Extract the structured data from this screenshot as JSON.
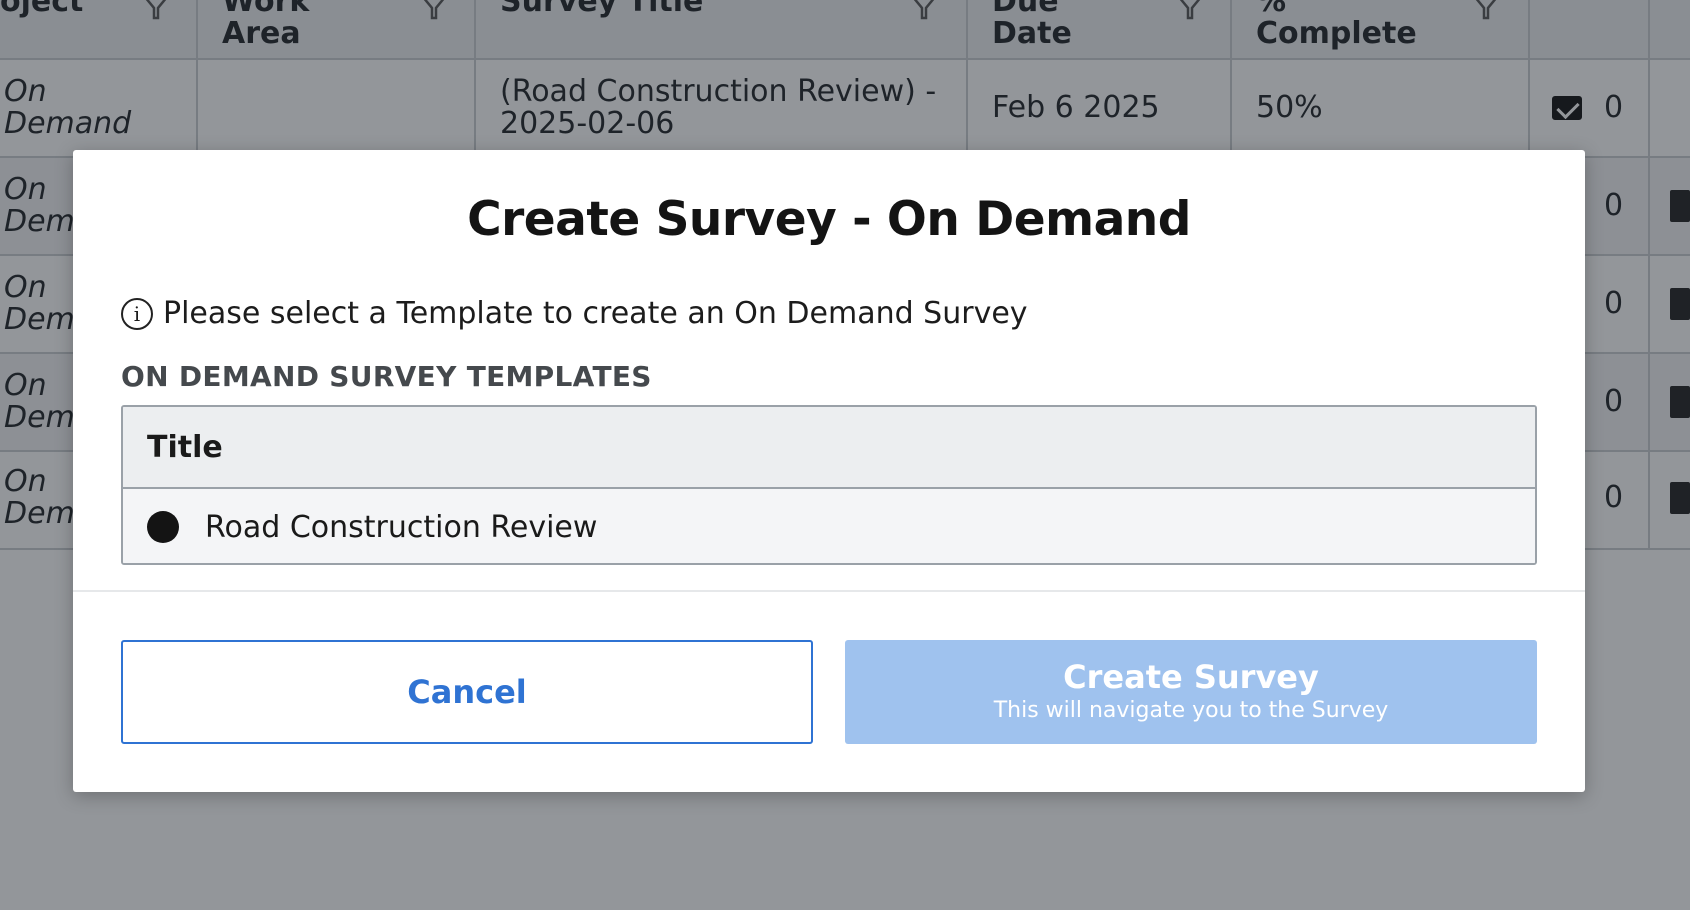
{
  "table": {
    "headers": [
      {
        "line1": "oject",
        "line2": ""
      },
      {
        "line1": "Work",
        "line2": "Area"
      },
      {
        "line1": "Survey Title",
        "line2": ""
      },
      {
        "line1": "Due",
        "line2": "Date"
      },
      {
        "line1": "%",
        "line2": "Complete"
      }
    ],
    "rows": [
      {
        "type_line1": "On",
        "type_line2": "Demand",
        "title_line1": "(Road Construction Review) -",
        "title_line2": "2025-02-06",
        "due": "Feb 6 2025",
        "complete": "50%",
        "count": "0"
      },
      {
        "type_line1": "On",
        "type_line2": "Dem",
        "count": "0"
      },
      {
        "type_line1": "On",
        "type_line2": "Dem",
        "count": "0"
      },
      {
        "type_line1": "On",
        "type_line2": "Dem",
        "count": "0"
      },
      {
        "type_line1": "On",
        "type_line2": "Dem",
        "count": "0"
      }
    ]
  },
  "modal": {
    "title": "Create Survey - On Demand",
    "info_text": "Please select a Template to create an On Demand Survey",
    "section_label": "ON DEMAND SURVEY TEMPLATES",
    "table_header": "Title",
    "templates": [
      {
        "title": "Road Construction Review",
        "selected": true
      }
    ],
    "cancel_label": "Cancel",
    "create_label": "Create Survey",
    "create_sublabel": "This will navigate you to the Survey"
  },
  "colors": {
    "accent": "#2f73d3",
    "create_disabled": "#9fc2ee",
    "overlay": "rgba(30,36,44,0.48)"
  }
}
